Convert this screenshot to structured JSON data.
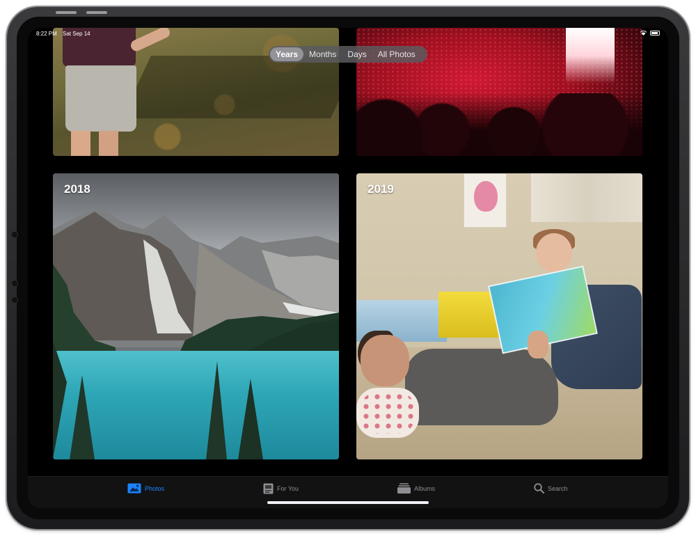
{
  "status_bar": {
    "time": "8:22 PM",
    "date": "Sat Sep 14"
  },
  "segmented_control": {
    "options": [
      "Years",
      "Months",
      "Days",
      "All Photos"
    ],
    "selected": "Years"
  },
  "tiles": [
    {
      "label": ""
    },
    {
      "label": ""
    },
    {
      "label": "2018"
    },
    {
      "label": "2019"
    }
  ],
  "tab_bar": {
    "items": [
      {
        "label": "Photos",
        "icon": "photos-icon",
        "active": true
      },
      {
        "label": "For You",
        "icon": "for-you-icon",
        "active": false
      },
      {
        "label": "Albums",
        "icon": "albums-icon",
        "active": false
      },
      {
        "label": "Search",
        "icon": "search-icon",
        "active": false
      }
    ]
  },
  "colors": {
    "accent": "#1a84ff",
    "tab_inactive": "#8e8e93",
    "background": "#000000"
  }
}
